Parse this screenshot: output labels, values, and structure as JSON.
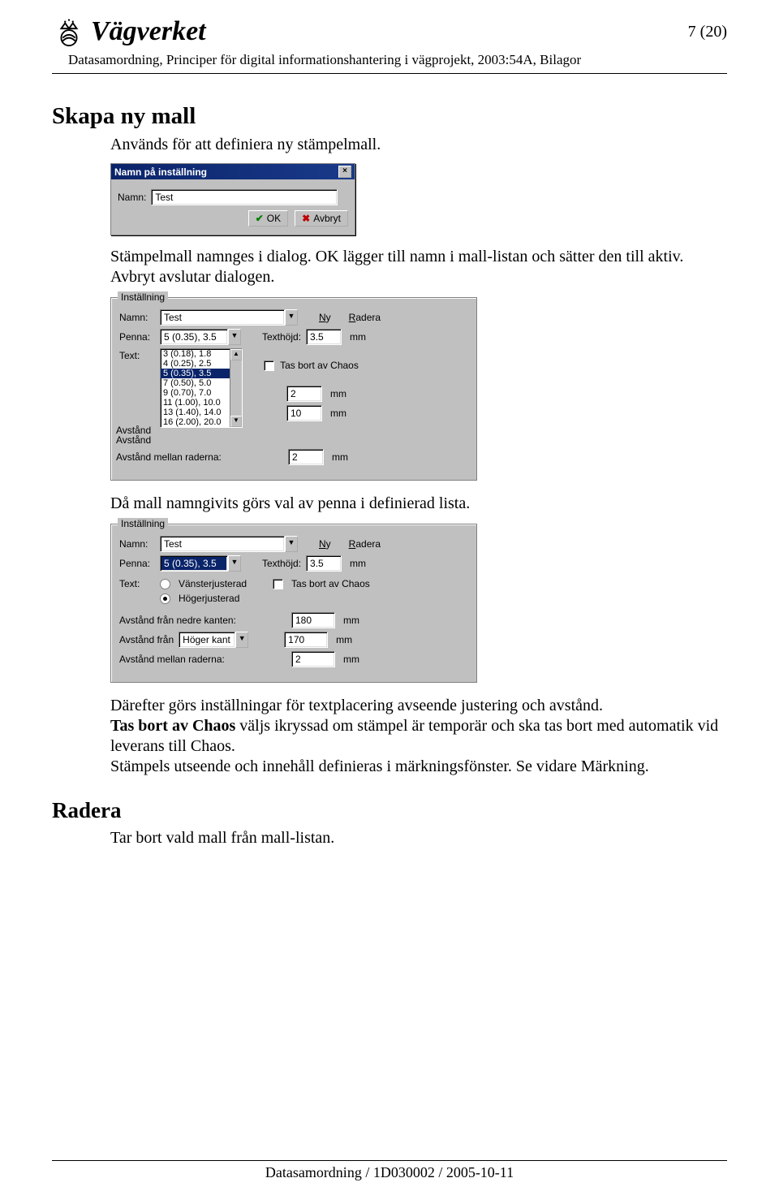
{
  "header": {
    "logo_text": "Vägverket",
    "page_number": "7 (20)",
    "doc_title": "Datasamordning, Principer för digital informationshantering i vägprojekt, 2003:54A, Bilagor"
  },
  "section1": {
    "heading": "Skapa ny mall",
    "para": "Används för att definiera ny stämpelmall."
  },
  "dialog1": {
    "title": "Namn på inställning",
    "name_label": "Namn:",
    "name_value": "Test",
    "ok": "OK",
    "cancel": "Avbryt"
  },
  "para2": "Stämpelmall namnges i dialog. OK lägger till namn i mall-listan och sätter den till aktiv. Avbryt avslutar dialogen.",
  "panel1": {
    "group": "Inställning",
    "namn_label": "Namn:",
    "namn_value": "Test",
    "ny": "Ny",
    "radera": "Radera",
    "penna_label": "Penna:",
    "penna_value": "5 (0.35), 3.5",
    "texthojd_label": "Texthöjd:",
    "texthojd_value": "3.5",
    "mm": "mm",
    "text_label": "Text:",
    "penna_options": [
      "3 (0.18), 1.8",
      "4 (0.25), 2.5",
      "5 (0.35), 3.5",
      "7 (0.50), 5.0",
      "9 (0.70), 7.0",
      "11 (1.00), 10.0",
      "13 (1.40), 14.0",
      "16 (2.00), 20.0"
    ],
    "tasbort": "Tas bort av Chaos",
    "avstand_label": "Avstånd",
    "avstand1_value": "2",
    "avstand2_label": "Avstånd",
    "avstand2_value": "10",
    "avstand3_label": "Avstånd mellan raderna:",
    "avstand3_value": "2"
  },
  "para3": "Då mall namngivits görs val av penna i definierad lista.",
  "panel2": {
    "group": "Inställning",
    "namn_label": "Namn:",
    "namn_value": "Test",
    "ny": "Ny",
    "radera": "Radera",
    "penna_label": "Penna:",
    "penna_value": "5 (0.35), 3.5",
    "texthojd_label": "Texthöjd:",
    "texthojd_value": "3.5",
    "mm": "mm",
    "text_label": "Text:",
    "vanster": "Vänsterjusterad",
    "hoger": "Högerjusterad",
    "tasbort": "Tas bort av Chaos",
    "avstand1_label": "Avstånd från nedre kanten:",
    "avstand1_value": "180",
    "avstand2_label": "Avstånd från",
    "avstand2_combo": "Höger kant",
    "avstand2_value": "170",
    "avstand3_label": "Avstånd mellan raderna:",
    "avstand3_value": "2"
  },
  "para4a": "Därefter görs inställningar för textplacering avseende justering och avstånd.",
  "para4b_prefix": "Tas bort av Chaos",
  "para4b_rest": " väljs ikryssad om stämpel är temporär och ska tas bort med automatik vid leverans till Chaos.",
  "para4c": "Stämpels utseende och innehåll definieras i märkningsfönster. Se vidare Märkning.",
  "section2": {
    "heading": "Radera",
    "para": "Tar bort vald mall från mall-listan."
  },
  "footer": "Datasamordning / 1D030002 / 2005-10-11"
}
